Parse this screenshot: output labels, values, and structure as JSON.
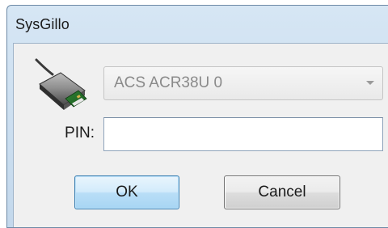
{
  "window": {
    "title": "SysGillo"
  },
  "reader": {
    "icon": "smart-card-reader-icon",
    "selected": "ACS ACR38U 0"
  },
  "pin": {
    "label": "PIN:",
    "value": ""
  },
  "buttons": {
    "ok_label": "OK",
    "cancel_label": "Cancel"
  },
  "colors": {
    "frame": "#c3d8ec",
    "client": "#f0f0f0",
    "ok_accent": "#3c7fb1"
  }
}
